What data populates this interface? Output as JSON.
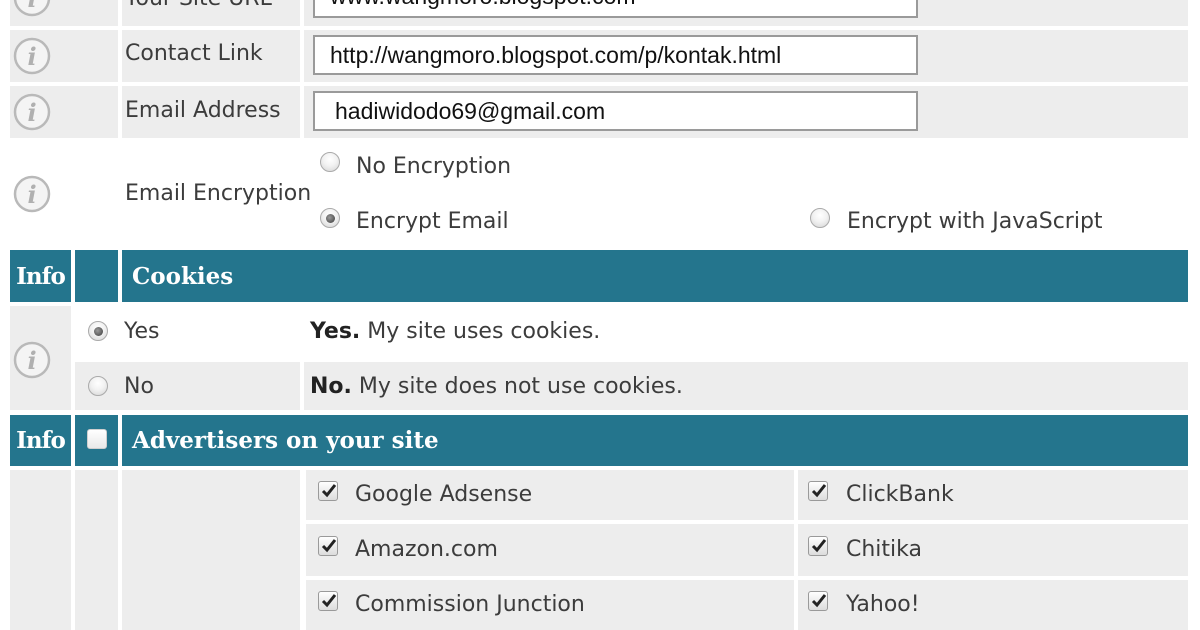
{
  "form": {
    "site_url": {
      "label": "Your Site URL",
      "value": "www.wangmoro.blogspot.com"
    },
    "contact_link": {
      "label": "Contact Link",
      "value": "http://wangmoro.blogspot.com/p/kontak.html"
    },
    "email_address": {
      "label": "Email Address",
      "value": "hadiwidodo69@gmail.com"
    },
    "email_encryption": {
      "label": "Email Encryption",
      "options": [
        "No Encryption",
        "Encrypt Email",
        "Encrypt with JavaScript"
      ],
      "selected": "Encrypt Email"
    }
  },
  "cookies_section": {
    "info": "Info",
    "title": "Cookies",
    "options": [
      {
        "label": "Yes",
        "bold": "Yes.",
        "desc": "My site uses cookies.",
        "checked": true
      },
      {
        "label": "No",
        "bold": "No.",
        "desc": "My site does not use cookies.",
        "checked": false
      }
    ]
  },
  "advertisers_section": {
    "info": "Info",
    "title": "Advertisers on your site",
    "select_all_checked": false,
    "items": [
      {
        "label": "Google Adsense",
        "checked": true
      },
      {
        "label": "ClickBank",
        "checked": true
      },
      {
        "label": "Amazon.com",
        "checked": true
      },
      {
        "label": "Chitika",
        "checked": true
      },
      {
        "label": "Commission Junction",
        "checked": true
      },
      {
        "label": "Yahoo!",
        "checked": true
      }
    ]
  },
  "colors": {
    "header_bg": "#24758d",
    "row_bg": "#ededed",
    "icon": "info-icon"
  }
}
